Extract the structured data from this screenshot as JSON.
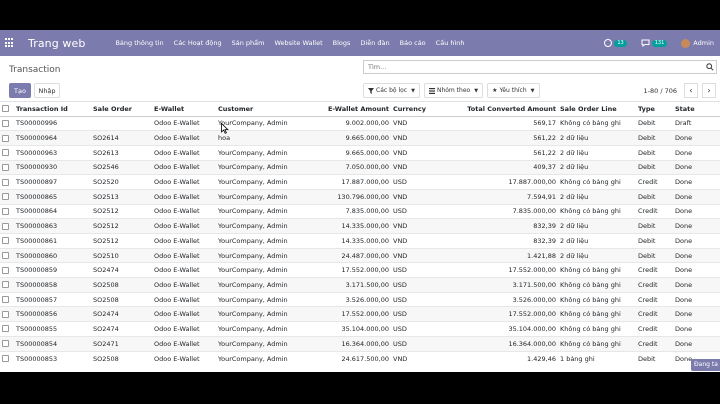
{
  "navbar": {
    "brand": "Trang web",
    "menu": [
      "Bảng thông tin",
      "Các Hoạt động",
      "Sản phẩm",
      "Website Wallet",
      "Blogs",
      "Diễn đàn",
      "Báo cáo",
      "Cấu hình"
    ],
    "activity_count": "13",
    "messages_count": "131",
    "user_name": "Admin"
  },
  "control_panel": {
    "title": "Transaction",
    "create_label": "Tạo",
    "import_label": "Nhập",
    "search_placeholder": "Tìm...",
    "filters_label": "Các bộ lọc",
    "group_by_label": "Nhóm theo",
    "favorites_label": "Yêu thích",
    "pager_value": "1-80 / 706"
  },
  "table": {
    "columns": [
      "Transaction Id",
      "Sale Order",
      "E-Wallet",
      "Customer",
      "E-Wallet Amount",
      "Currency",
      "Total Converted Amount",
      "Sale Order Line",
      "Type",
      "State"
    ],
    "rows": [
      [
        "TS00000996",
        "",
        "Odoo E-Wallet",
        "YourCompany, Admin",
        "9.002.000,00",
        "VND",
        "569,17",
        "Không có bảng ghi",
        "Debit",
        "Draft"
      ],
      [
        "TS00000964",
        "SO2614",
        "Odoo E-Wallet",
        "hoa",
        "9.665.000,00",
        "VND",
        "561,22",
        "2 dữ liệu",
        "Debit",
        "Done"
      ],
      [
        "TS00000963",
        "SO2613",
        "Odoo E-Wallet",
        "YourCompany, Admin",
        "9.665.000,00",
        "VND",
        "561,22",
        "2 dữ liệu",
        "Debit",
        "Done"
      ],
      [
        "TS00000930",
        "SO2546",
        "Odoo E-Wallet",
        "YourCompany, Admin",
        "7.050.000,00",
        "VND",
        "409,37",
        "2 dữ liệu",
        "Debit",
        "Done"
      ],
      [
        "TS00000897",
        "SO2520",
        "Odoo E-Wallet",
        "YourCompany, Admin",
        "17.887.000,00",
        "USD",
        "17.887.000,00",
        "Không có bảng ghi",
        "Credit",
        "Done"
      ],
      [
        "TS00000865",
        "SO2513",
        "Odoo E-Wallet",
        "YourCompany, Admin",
        "130.796.000,00",
        "VND",
        "7.594,91",
        "2 dữ liệu",
        "Debit",
        "Done"
      ],
      [
        "TS00000864",
        "SO2512",
        "Odoo E-Wallet",
        "YourCompany, Admin",
        "7.835.000,00",
        "USD",
        "7.835.000,00",
        "Không có bảng ghi",
        "Credit",
        "Done"
      ],
      [
        "TS00000863",
        "SO2512",
        "Odoo E-Wallet",
        "YourCompany, Admin",
        "14.335.000,00",
        "VND",
        "832,39",
        "2 dữ liệu",
        "Debit",
        "Done"
      ],
      [
        "TS00000861",
        "SO2512",
        "Odoo E-Wallet",
        "YourCompany, Admin",
        "14.335.000,00",
        "VND",
        "832,39",
        "2 dữ liệu",
        "Debit",
        "Done"
      ],
      [
        "TS00000860",
        "SO2510",
        "Odoo E-Wallet",
        "YourCompany, Admin",
        "24.487.000,00",
        "VND",
        "1.421,88",
        "2 dữ liệu",
        "Debit",
        "Done"
      ],
      [
        "TS00000859",
        "SO2474",
        "Odoo E-Wallet",
        "YourCompany, Admin",
        "17.552.000,00",
        "USD",
        "17.552.000,00",
        "Không có bảng ghi",
        "Credit",
        "Done"
      ],
      [
        "TS00000858",
        "SO2508",
        "Odoo E-Wallet",
        "YourCompany, Admin",
        "3.171.500,00",
        "USD",
        "3.171.500,00",
        "Không có bảng ghi",
        "Credit",
        "Done"
      ],
      [
        "TS00000857",
        "SO2508",
        "Odoo E-Wallet",
        "YourCompany, Admin",
        "3.526.000,00",
        "USD",
        "3.526.000,00",
        "Không có bảng ghi",
        "Credit",
        "Done"
      ],
      [
        "TS00000856",
        "SO2474",
        "Odoo E-Wallet",
        "YourCompany, Admin",
        "17.552.000,00",
        "USD",
        "17.552.000,00",
        "Không có bảng ghi",
        "Credit",
        "Done"
      ],
      [
        "TS00000855",
        "SO2474",
        "Odoo E-Wallet",
        "YourCompany, Admin",
        "35.104.000,00",
        "USD",
        "35.104.000,00",
        "Không có bảng ghi",
        "Credit",
        "Done"
      ],
      [
        "TS00000854",
        "SO2471",
        "Odoo E-Wallet",
        "YourCompany, Admin",
        "16.364.000,00",
        "USD",
        "16.364.000,00",
        "Không có bảng ghi",
        "Credit",
        "Done"
      ],
      [
        "TS00000853",
        "SO2508",
        "Odoo E-Wallet",
        "YourCompany, Admin",
        "24.617.500,00",
        "VND",
        "1.429,46",
        "1 bảng ghi",
        "Debit",
        "Done"
      ]
    ]
  },
  "loading_label": "Đang ta",
  "colors": {
    "navbar": "#7c7bad",
    "primary_button": "#7c7bad",
    "badge": "#00a09d"
  }
}
